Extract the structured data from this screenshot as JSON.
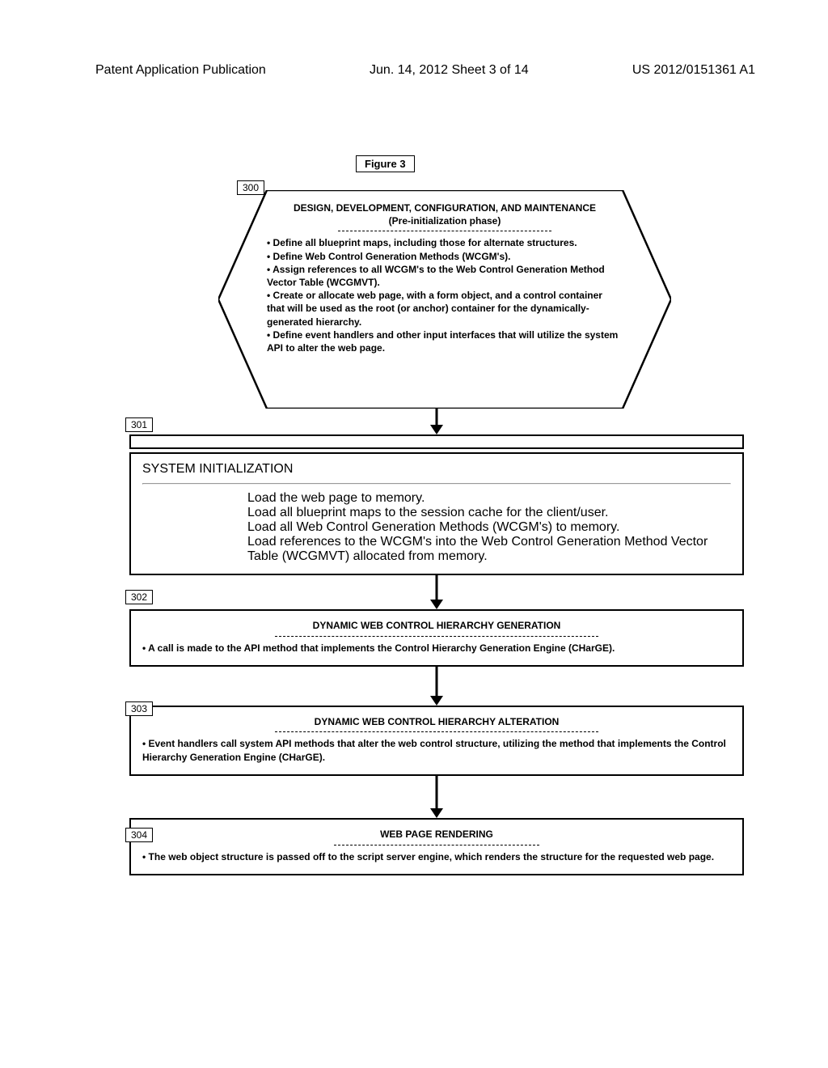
{
  "header": {
    "left": "Patent Application Publication",
    "mid": "Jun. 14, 2012  Sheet 3 of 14",
    "right": "US 2012/0151361 A1"
  },
  "figure_title": "Figure 3",
  "refs": {
    "r300": "300",
    "r301": "301",
    "r302": "302",
    "r303": "303",
    "r304": "304"
  },
  "hex": {
    "title": "DESIGN, DEVELOPMENT, CONFIGURATION, AND MAINTENANCE",
    "sub": "(Pre-initialization phase)",
    "b1": "Define all blueprint maps, including those for alternate structures.",
    "b2": "Define Web Control Generation Methods (WCGM's).",
    "b3": "Assign references to all WCGM's to the Web Control Generation Method Vector Table (WCGMVT).",
    "b4": "Create or allocate web page, with a form object, and a control container that will be used as the root (or anchor) container for the dynamically-generated hierarchy.",
    "b5": "Define event handlers and other input interfaces that will utilize the system API to alter the web page."
  },
  "box301": {
    "title": "SYSTEM INITIALIZATION",
    "b1": "Load the web page to memory.",
    "b2": "Load all blueprint maps to the session cache for the client/user.",
    "b3": "Load all Web Control Generation Methods (WCGM's) to memory.",
    "b4": "Load references to the WCGM's into the Web Control Generation Method Vector Table (WCGMVT) allocated from memory."
  },
  "box302": {
    "title": "DYNAMIC WEB CONTROL HIERARCHY GENERATION",
    "b1": "A call is made to the API method that implements the Control Hierarchy Generation Engine (CHarGE)."
  },
  "box303": {
    "title": "DYNAMIC WEB CONTROL HIERARCHY ALTERATION",
    "b1": "Event handlers call system API methods that alter the web control structure, utilizing the method that implements the Control Hierarchy Generation Engine (CHarGE)."
  },
  "box304": {
    "title": "WEB PAGE RENDERING",
    "b1": "The web object structure is passed off to the script server engine, which renders the structure for the requested web page."
  }
}
